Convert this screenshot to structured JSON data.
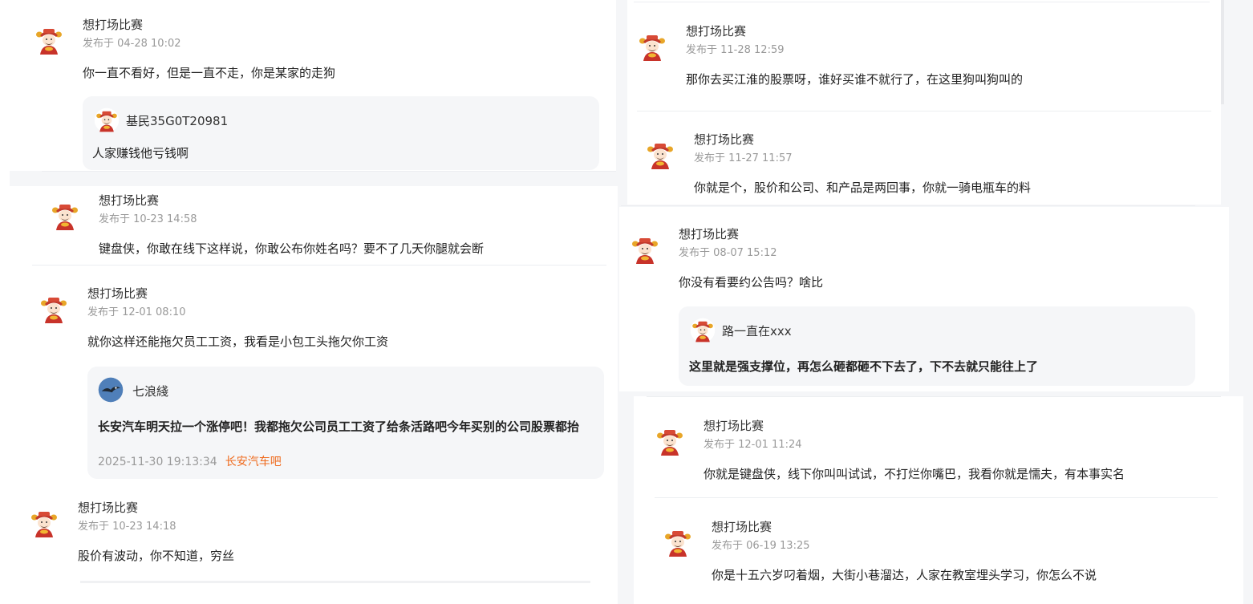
{
  "colors": {
    "forum_link": "#ef6b1e",
    "time": "#999999",
    "quote_bg": "#f5f6f8"
  },
  "posts": [
    {
      "author": "想打场比赛",
      "time": "发布于 04-28 10:02",
      "content": "你一直不看好，但是一直不走，你是某家的走狗",
      "avatar_icon": "caishen-avatar-icon",
      "quote": {
        "author": "基民35G0T20981",
        "content": "人家赚钱他亏钱啊",
        "avatar_icon": "caishen-avatar-icon"
      }
    },
    {
      "author": "想打场比赛",
      "time": "发布于 10-23 14:58",
      "content": "键盘侠，你敢在线下这样说，你敢公布你姓名吗？要不了几天你腿就会断",
      "avatar_icon": "caishen-avatar-icon"
    },
    {
      "author": "想打场比赛",
      "time": "发布于 12-01 08:10",
      "content": "就你这样还能拖欠员工工资，我看是小包工头拖欠你工资",
      "avatar_icon": "caishen-avatar-icon",
      "quote": {
        "author": "七浪綫",
        "content": "长安汽车明天拉一个涨停吧！我都拖欠公司员工工资了给条活路吧今年买别的公司股票都抬",
        "date": "2025-11-30 19:13:34",
        "forum": "长安汽车吧",
        "avatar_icon": "eagle-avatar-icon"
      }
    },
    {
      "author": "想打场比赛",
      "time": "发布于 10-23 14:18",
      "content": "股价有波动，你不知道，穷丝",
      "avatar_icon": "caishen-avatar-icon"
    },
    {
      "author": "想打场比赛",
      "time": "发布于 11-28 12:59",
      "content": "那你去买江淮的股票呀，谁好买谁不就行了，在这里狗叫狗叫的",
      "avatar_icon": "caishen-avatar-icon"
    },
    {
      "author": "想打场比赛",
      "time": "发布于 11-27 11:57",
      "content": "你就是个，股价和公司、和产品是两回事，你就一骑电瓶车的料",
      "avatar_icon": "caishen-avatar-icon"
    },
    {
      "author": "想打场比赛",
      "time": "发布于 08-07 15:12",
      "content": "你没有看要约公告吗？啥比",
      "avatar_icon": "caishen-avatar-icon",
      "quote": {
        "author": "路一直在xxx",
        "content": "这里就是强支撑位，再怎么砸都砸不下去了，下不去就只能往上了",
        "avatar_icon": "caishen-avatar-icon"
      }
    },
    {
      "author": "想打场比赛",
      "time": "发布于 12-01 11:24",
      "content": "你就是键盘侠，线下你叫叫试试，不打烂你嘴巴，我看你就是懦夫，有本事实名",
      "avatar_icon": "caishen-avatar-icon"
    },
    {
      "author": "想打场比赛",
      "time": "发布于 06-19 13:25",
      "content": "你是十五六岁叼着烟，大街小巷溜达，人家在教室埋头学习，你怎么不说",
      "avatar_icon": "caishen-avatar-icon"
    }
  ]
}
